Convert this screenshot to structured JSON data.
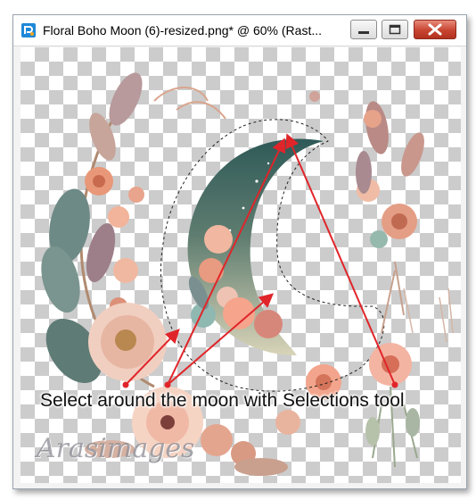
{
  "window": {
    "title": "Floral Boho Moon (6)-resized.png* @  60% (Rast...",
    "controls": {
      "minimize": "minimize",
      "maximize": "maximize",
      "close": "close"
    }
  },
  "canvas": {
    "instruction": "Select around the moon with Selections tool",
    "watermark": "Arasimages",
    "accent_arrow_color": "#e0252a",
    "moon_top_color": "#2f5a58",
    "moon_bottom_color": "#d8d4b8"
  }
}
